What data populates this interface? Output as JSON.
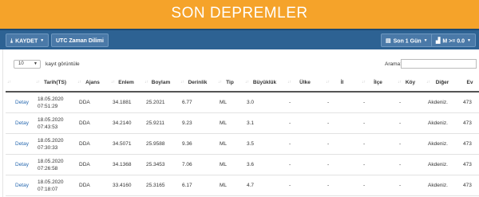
{
  "header": {
    "title": "SON DEPREMLER"
  },
  "toolbar": {
    "save": "KAYDET",
    "utc": "UTC Zaman Dilimi",
    "period": "Son 1 Gün",
    "magnitude": "M >= 0.0"
  },
  "controls": {
    "page_length": "10",
    "page_length_label": "kayıt görüntüle",
    "search_label": "Arama:",
    "search_value": ""
  },
  "table": {
    "columns": [
      "Tarih(TS)",
      "Ajans",
      "Enlem",
      "Boylam",
      "Derinlik",
      "Tip",
      "Büyüklük",
      "Ülke",
      "İl",
      "İlçe",
      "Köy",
      "Diğer",
      "Ev"
    ],
    "detail_label": "Detay",
    "rows": [
      {
        "date": "18.05.2020",
        "time": "07:51:29",
        "agency": "DDA",
        "lat": "34.1881",
        "lon": "25.2021",
        "depth": "6.77",
        "type": "ML",
        "mag": "3.0",
        "country": "-",
        "il": "-",
        "ilce": "-",
        "koy": "-",
        "other": "Akdeniz.",
        "ev": "473"
      },
      {
        "date": "18.05.2020",
        "time": "07:43:53",
        "agency": "DDA",
        "lat": "34.2140",
        "lon": "25.9211",
        "depth": "9.23",
        "type": "ML",
        "mag": "3.1",
        "country": "-",
        "il": "-",
        "ilce": "-",
        "koy": "-",
        "other": "Akdeniz.",
        "ev": "473"
      },
      {
        "date": "18.05.2020",
        "time": "07:30:33",
        "agency": "DDA",
        "lat": "34.5071",
        "lon": "25.9588",
        "depth": "9.36",
        "type": "ML",
        "mag": "3.5",
        "country": "-",
        "il": "-",
        "ilce": "-",
        "koy": "-",
        "other": "Akdeniz.",
        "ev": "473"
      },
      {
        "date": "18.05.2020",
        "time": "07:26:58",
        "agency": "DDA",
        "lat": "34.1368",
        "lon": "25.3453",
        "depth": "7.06",
        "type": "ML",
        "mag": "3.6",
        "country": "-",
        "il": "-",
        "ilce": "-",
        "koy": "-",
        "other": "Akdeniz.",
        "ev": "473"
      },
      {
        "date": "18.05.2020",
        "time": "07:18:07",
        "agency": "DDA",
        "lat": "33.4160",
        "lon": "25.3165",
        "depth": "6.17",
        "type": "ML",
        "mag": "4.7",
        "country": "-",
        "il": "-",
        "ilce": "-",
        "koy": "-",
        "other": "Akdeniz.",
        "ev": "473"
      }
    ]
  }
}
